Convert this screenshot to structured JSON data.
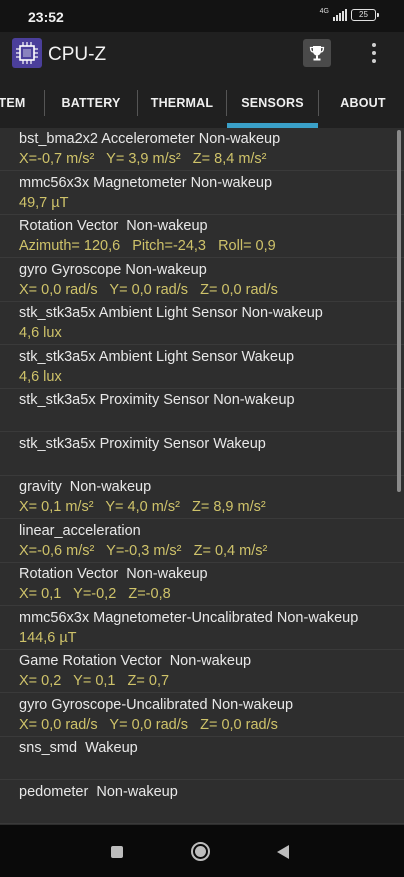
{
  "status_bar": {
    "time": "23:52",
    "network": "4G",
    "battery": "25"
  },
  "app": {
    "title": "CPU-Z"
  },
  "tabs": [
    {
      "label": "TEM",
      "active": false
    },
    {
      "label": "BATTERY",
      "active": false
    },
    {
      "label": "THERMAL",
      "active": false
    },
    {
      "label": "SENSORS",
      "active": true
    },
    {
      "label": "ABOUT",
      "active": false
    }
  ],
  "sensors": [
    {
      "name": "bst_bma2x2 Accelerometer Non-wakeup",
      "value": "X=-0,7 m/s²   Y= 3,9 m/s²   Z= 8,4 m/s²"
    },
    {
      "name": "mmc56x3x Magnetometer Non-wakeup",
      "value": "49,7 µT"
    },
    {
      "name": "Rotation Vector  Non-wakeup",
      "value": "Azimuth= 120,6   Pitch=-24,3   Roll= 0,9"
    },
    {
      "name": "gyro Gyroscope Non-wakeup",
      "value": "X= 0,0 rad/s   Y= 0,0 rad/s   Z= 0,0 rad/s"
    },
    {
      "name": "stk_stk3a5x Ambient Light Sensor Non-wakeup",
      "value": "4,6 lux"
    },
    {
      "name": "stk_stk3a5x Ambient Light Sensor Wakeup",
      "value": "4,6 lux"
    },
    {
      "name": "stk_stk3a5x Proximity Sensor Non-wakeup",
      "value": ""
    },
    {
      "name": "stk_stk3a5x Proximity Sensor Wakeup",
      "value": ""
    },
    {
      "name": "gravity  Non-wakeup",
      "value": "X= 0,1 m/s²   Y= 4,0 m/s²   Z= 8,9 m/s²"
    },
    {
      "name": "linear_acceleration",
      "value": "X=-0,6 m/s²   Y=-0,3 m/s²   Z= 0,4 m/s²"
    },
    {
      "name": "Rotation Vector  Non-wakeup",
      "value": "X= 0,1   Y=-0,2   Z=-0,8"
    },
    {
      "name": "mmc56x3x Magnetometer-Uncalibrated Non-wakeup",
      "value": "144,6 µT"
    },
    {
      "name": "Game Rotation Vector  Non-wakeup",
      "value": "X= 0,2   Y= 0,1   Z= 0,7"
    },
    {
      "name": "gyro Gyroscope-Uncalibrated Non-wakeup",
      "value": "X= 0,0 rad/s   Y= 0,0 rad/s   Z= 0,0 rad/s"
    },
    {
      "name": "sns_smd  Wakeup",
      "value": ""
    },
    {
      "name": "pedometer  Non-wakeup",
      "value": ""
    }
  ],
  "icons": {
    "app_logo": "cpu-chip-icon",
    "trophy": "trophy-icon",
    "menu": "overflow-menu-icon",
    "recents": "nav-recents-icon",
    "home": "nav-home-icon",
    "back": "nav-back-icon"
  },
  "colors": {
    "accent": "#3aa0c8",
    "value_text": "#cfc36a",
    "logo": "#4b3f9b"
  }
}
